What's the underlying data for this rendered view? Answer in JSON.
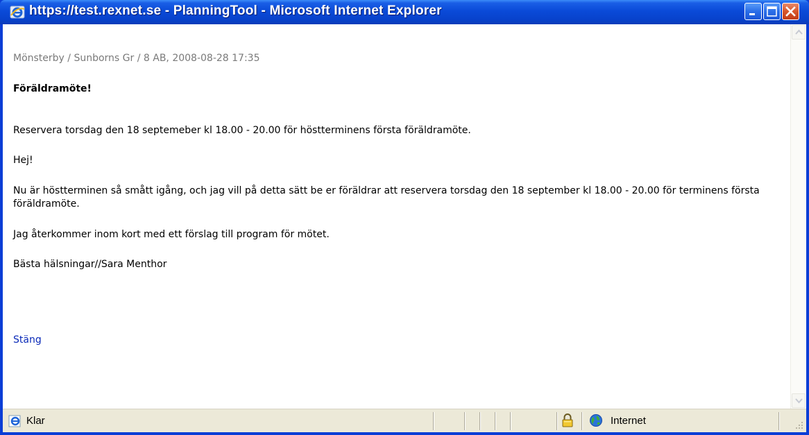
{
  "window": {
    "title": "https://test.rexnet.se - PlanningTool - Microsoft Internet Explorer"
  },
  "message": {
    "breadcrumb": "Mönsterby / Sunborns Gr / 8 AB, 2008-08-28 17:35",
    "heading": "Föräldramöte!",
    "summary": "Reservera torsdag den 18 septemeber kl 18.00 - 20.00 för höstterminens första föräldramöte.",
    "greeting": "Hej!",
    "body": "Nu är höstterminen så smått igång, och jag vill på detta sätt be er föräldrar att reservera torsdag den 18 september kl 18.00 - 20.00 för terminens första föräldramöte.",
    "followup": "Jag återkommer inom kort med ett förslag till program för mötet.",
    "signature": "Bästa hälsningar//Sara Menthor",
    "close_link": "Stäng"
  },
  "statusbar": {
    "status": "Klar",
    "zone": "Internet"
  },
  "colors": {
    "titlebar": "#0a4ad8",
    "link": "#0a2ab8",
    "breadcrumb": "#7a7a7a",
    "statusbar": "#ece9d8"
  }
}
